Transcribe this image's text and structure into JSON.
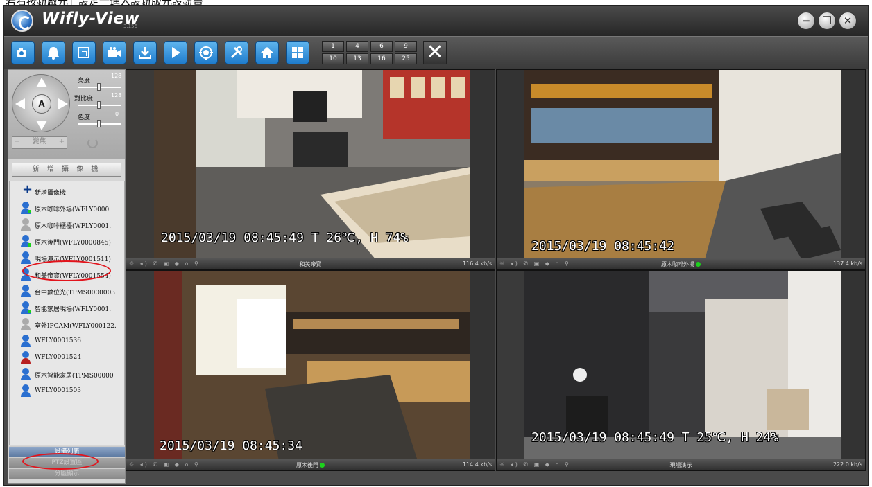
{
  "caption": "若右按鈕啟元」設定一進入設鈕版元設鈕畫",
  "app": {
    "title": "Wifly-View",
    "version": "3.156"
  },
  "window_buttons": [
    {
      "name": "minimize-button",
      "icon": "minus-icon",
      "glyph": "−"
    },
    {
      "name": "restore-button",
      "icon": "restore-icon",
      "glyph": "❐"
    },
    {
      "name": "close-window-button",
      "icon": "close-icon",
      "glyph": "✕"
    }
  ],
  "toolbar": {
    "buttons": [
      {
        "name": "camera-config-button",
        "icon": "camera-icon"
      },
      {
        "name": "alarm-button",
        "icon": "bell-icon"
      },
      {
        "name": "export-button",
        "icon": "export-icon"
      },
      {
        "name": "record-button",
        "icon": "video-camera-icon"
      },
      {
        "name": "download-button",
        "icon": "download-icon"
      },
      {
        "name": "play-button",
        "icon": "play-icon"
      },
      {
        "name": "target-button",
        "icon": "target-icon"
      },
      {
        "name": "tools-button",
        "icon": "tools-icon"
      },
      {
        "name": "home-button",
        "icon": "home-icon"
      },
      {
        "name": "layout-button",
        "icon": "grid-icon"
      }
    ],
    "layout_row1": [
      "1",
      "4",
      "6",
      "9"
    ],
    "layout_row2": [
      "10",
      "13",
      "16",
      "25"
    ],
    "close_label": "✕"
  },
  "ptz": {
    "center_label": "A",
    "brightness": {
      "label": "亮度",
      "value": "128",
      "level": 0.5
    },
    "contrast": {
      "label": "對比度",
      "value": "128",
      "level": 0.5
    },
    "saturation": {
      "label": "色度",
      "value": "0",
      "level": 0.5
    },
    "zoom_minus": "−",
    "zoom_label": "變焦",
    "zoom_plus": "+"
  },
  "add_camera_button": "新 增 攝 像 機",
  "devices": [
    {
      "label": "新增攝像機",
      "icon": "plus-icon",
      "state": "add"
    },
    {
      "label": "原木咖啡外場(WFLY0000",
      "icon": "camera-icon",
      "state": "online-green"
    },
    {
      "label": "原木咖啡櫃檯(WFLY0001.",
      "icon": "camera-icon",
      "state": "offline"
    },
    {
      "label": "原木後門(WFLY0000845)",
      "icon": "camera-icon",
      "state": "online-green"
    },
    {
      "label": "現場演示(WFLY0001511)",
      "icon": "camera-icon",
      "state": "online"
    },
    {
      "label": "和美帝寶(WFLY0001554)",
      "icon": "camera-icon",
      "state": "online"
    },
    {
      "label": "台中數位光(TPMS0000003",
      "icon": "camera-icon",
      "state": "online"
    },
    {
      "label": "智能家居現場(WFLY0001.",
      "icon": "camera-icon",
      "state": "online-green"
    },
    {
      "label": "室外IPCAM(WFLY000122.",
      "icon": "camera-icon",
      "state": "offline"
    },
    {
      "label": "WFLY0001536",
      "icon": "camera-icon",
      "state": "online"
    },
    {
      "label": "WFLY0001524",
      "icon": "camera-icon",
      "state": "red"
    },
    {
      "label": "原木智能家居(TPMS00000",
      "icon": "camera-icon",
      "state": "online"
    },
    {
      "label": "WFLY0001503",
      "icon": "camera-icon",
      "state": "online"
    }
  ],
  "bottom_tabs": [
    "設備列表",
    "PTZ設置區",
    "分區顯示"
  ],
  "tiles": [
    {
      "name": "和美帝寶",
      "osd": "2015/03/19 08:45:49  T 26℃, H 74%",
      "rate": "116.4 kb/s",
      "online_dot": false
    },
    {
      "name": "原木咖啡外場",
      "osd": "2015/03/19 08:45:42",
      "rate": "137.4 kb/s",
      "online_dot": true
    },
    {
      "name": "原木後門",
      "osd": "2015/03/19 08:45:34",
      "rate": "114.4 kb/s",
      "online_dot": true
    },
    {
      "name": "現場演示",
      "osd": "2015/03/19 08:45:49  T 25℃, H 24%",
      "rate": "222.0 kb/s",
      "online_dot": false
    }
  ],
  "tile_status_icons": "☼ ◂) ✆ ▣ ◆ ⌂ ♀",
  "colors": {
    "accent": "#1f7ccc",
    "online": "#1dd11d",
    "highlight": "#e2141c"
  }
}
